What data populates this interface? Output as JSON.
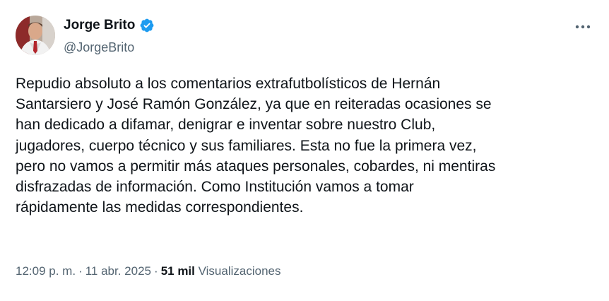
{
  "author": {
    "display_name": "Jorge Brito",
    "handle": "@JorgeBrito",
    "verified": true,
    "verified_icon": "verified-badge-icon",
    "verified_color": "#1d9bf0"
  },
  "more_icon": "more-horizontal-icon",
  "tweet": {
    "text": "Repudio absoluto a los comentarios extrafutbolísticos de Hernán\nSantarsiero y José Ramón González, ya que en reiteradas ocasiones se\nhan dedicado a difamar, denigrar e inventar sobre nuestro Club,\njugadores, cuerpo técnico y sus familiares. Esta no fue la primera vez,\npero no vamos a permitir más ataques personales, cobardes, ni mentiras\ndisfrazadas de información. Como Institución vamos a tomar\nrápidamente las medidas correspondientes."
  },
  "meta": {
    "time": "12:09 p. m.",
    "separator": "·",
    "date": "11 abr. 2025",
    "views_count": "51 mil",
    "views_label": "Visualizaciones"
  }
}
